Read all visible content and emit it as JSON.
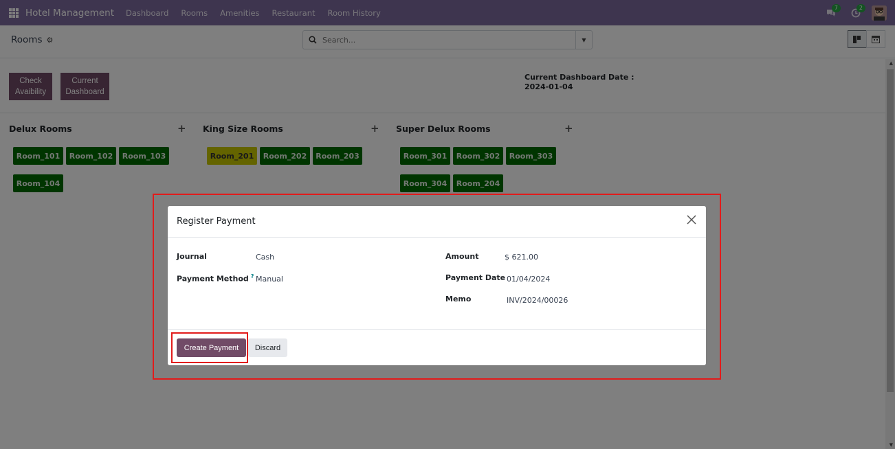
{
  "app": {
    "brand": "Hotel Management",
    "menu": [
      "Dashboard",
      "Rooms",
      "Amenities",
      "Restaurant",
      "Room History"
    ],
    "messages_count": "7",
    "activities_count": "2"
  },
  "control": {
    "breadcrumb": "Rooms",
    "search_placeholder": "Search..."
  },
  "toolbar": {
    "check_availability_label": "Check Avaibility",
    "current_dashboard_label": "Current Dashboard",
    "dashboard_date_label": "Current Dashboard Date :",
    "dashboard_date_value": "2024-01-04"
  },
  "groups": [
    {
      "title": "Delux Rooms",
      "rooms": [
        "Room_101",
        "Room_102",
        "Room_103",
        "Room_104"
      ]
    },
    {
      "title": "King Size Rooms",
      "rooms": [
        "Room_201",
        "Room_202",
        "Room_203"
      ]
    },
    {
      "title": "Super Delux Rooms",
      "rooms": [
        "Room_301",
        "Room_302",
        "Room_303",
        "Room_304",
        "Room_204"
      ]
    }
  ],
  "colors": {
    "navbar": "#7c6a9e",
    "primary": "#714b67",
    "room_green": "#006b00",
    "room_yellow": "#c8c800",
    "highlight": "#e21b1b"
  },
  "modal": {
    "title": "Register Payment",
    "journal_label": "Journal",
    "journal_value": "Cash",
    "payment_method_label": "Payment Method",
    "payment_method_help": "?",
    "payment_method_value": "Manual",
    "amount_label": "Amount",
    "amount_value": "$ 621.00",
    "payment_date_label": "Payment Date",
    "payment_date_value": "01/04/2024",
    "memo_label": "Memo",
    "memo_value": "INV/2024/00026",
    "create_label": "Create Payment",
    "discard_label": "Discard"
  }
}
